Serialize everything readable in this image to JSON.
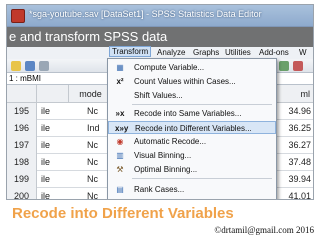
{
  "window": {
    "title": "*sga-youtube.sav [DataSet1] - SPSS Statistics Data Editor"
  },
  "overlay": {
    "caption": "e and transform SPSS data"
  },
  "menubar": {
    "items": [
      {
        "label": "Transform",
        "active": true
      },
      {
        "label": "Analyze",
        "active": false
      },
      {
        "label": "Graphs",
        "active": false
      },
      {
        "label": "Utilities",
        "active": false
      },
      {
        "label": "Add-ons",
        "active": false
      },
      {
        "label": "W",
        "active": false
      }
    ]
  },
  "cellref": {
    "name": "1 : mBMI"
  },
  "grid": {
    "headers": {
      "col2": "mode",
      "col4": "ml"
    },
    "rows": [
      {
        "num": "195",
        "c1": "ile",
        "c2": "Nc",
        "c4": "34.96"
      },
      {
        "num": "196",
        "c1": "ile",
        "c2": "Ind",
        "c4": "36.25"
      },
      {
        "num": "197",
        "c1": "ile",
        "c2": "Nc",
        "c4": "36.27"
      },
      {
        "num": "198",
        "c1": "ile",
        "c2": "Nc",
        "c4": "37.48"
      },
      {
        "num": "199",
        "c1": "ile",
        "c2": "Nc",
        "c4": "39.94"
      },
      {
        "num": "200",
        "c1": "ile",
        "c2": "Nc",
        "c4": "41.01"
      }
    ]
  },
  "transform_menu": {
    "items": [
      {
        "label": "Compute Variable...",
        "icon": "calculator-icon",
        "glyph": "▦",
        "highlight": false
      },
      {
        "label": "Count Values within Cases...",
        "icon": "count-icon",
        "glyph": "x²",
        "highlight": false
      },
      {
        "label": "Shift Values...",
        "icon": "shift-icon",
        "glyph": "",
        "highlight": false
      },
      {
        "label": "Recode into Same Variables...",
        "icon": "recode-same-icon",
        "glyph": "»x",
        "highlight": false
      },
      {
        "label": "Recode into Different Variables...",
        "icon": "recode-different-icon",
        "glyph": "x»y",
        "highlight": true
      },
      {
        "label": "Automatic Recode...",
        "icon": "auto-recode-icon",
        "glyph": "◉",
        "highlight": false
      },
      {
        "label": "Visual Binning...",
        "icon": "visual-binning-icon",
        "glyph": "▥",
        "highlight": false
      },
      {
        "label": "Optimal Binning...",
        "icon": "optimal-binning-icon",
        "glyph": "⚒",
        "highlight": false
      },
      {
        "label": "Rank Cases...",
        "icon": "rank-icon",
        "glyph": "▤",
        "highlight": false
      }
    ]
  },
  "bottom": {
    "title": "Recode into Different Variables",
    "credit": "©drtamil@gmail.com 2016",
    "title_color": "#f0a24a"
  }
}
